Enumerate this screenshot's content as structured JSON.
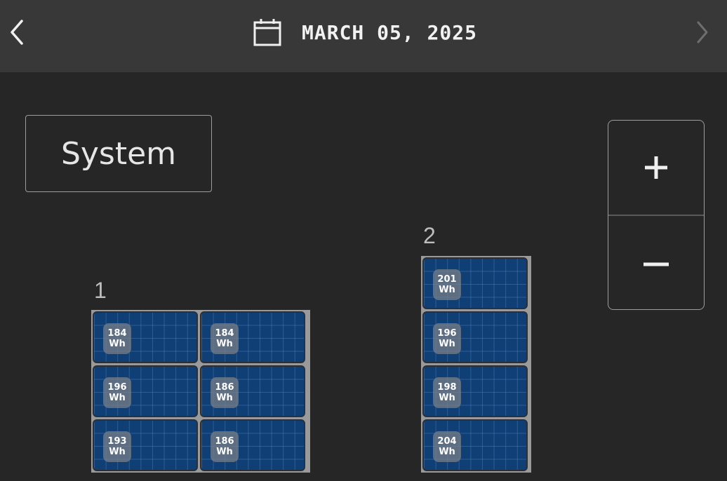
{
  "header": {
    "date": "MARCH 05, 2025",
    "prev_icon": "chevron-left-icon",
    "next_icon": "chevron-right-icon",
    "calendar_icon": "calendar-icon"
  },
  "system_button": {
    "label": "System"
  },
  "zoom": {
    "in_label": "+",
    "out_label": "−"
  },
  "arrays": [
    {
      "label": "1",
      "panels": [
        {
          "value": "184",
          "unit": "Wh"
        },
        {
          "value": "184",
          "unit": "Wh"
        },
        {
          "value": "196",
          "unit": "Wh"
        },
        {
          "value": "186",
          "unit": "Wh"
        },
        {
          "value": "193",
          "unit": "Wh"
        },
        {
          "value": "186",
          "unit": "Wh"
        }
      ]
    },
    {
      "label": "2",
      "panels": [
        {
          "value": "201",
          "unit": "Wh"
        },
        {
          "value": "196",
          "unit": "Wh"
        },
        {
          "value": "198",
          "unit": "Wh"
        },
        {
          "value": "204",
          "unit": "Wh"
        }
      ]
    }
  ],
  "colors": {
    "background": "#262626",
    "header": "#383838",
    "panel": "#0f3f74"
  }
}
